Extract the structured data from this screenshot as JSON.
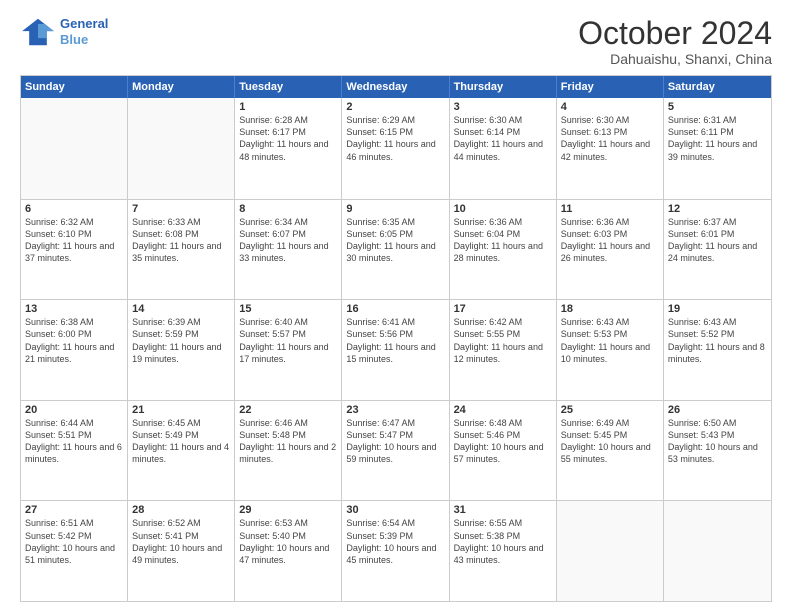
{
  "logo": {
    "line1": "General",
    "line2": "Blue"
  },
  "title": "October 2024",
  "location": "Dahuaishu, Shanxi, China",
  "days_of_week": [
    "Sunday",
    "Monday",
    "Tuesday",
    "Wednesday",
    "Thursday",
    "Friday",
    "Saturday"
  ],
  "weeks": [
    [
      {
        "day": "",
        "empty": true
      },
      {
        "day": "",
        "empty": true
      },
      {
        "day": "1",
        "sunrise": "6:28 AM",
        "sunset": "6:17 PM",
        "daylight": "11 hours and 48 minutes."
      },
      {
        "day": "2",
        "sunrise": "6:29 AM",
        "sunset": "6:15 PM",
        "daylight": "11 hours and 46 minutes."
      },
      {
        "day": "3",
        "sunrise": "6:30 AM",
        "sunset": "6:14 PM",
        "daylight": "11 hours and 44 minutes."
      },
      {
        "day": "4",
        "sunrise": "6:30 AM",
        "sunset": "6:13 PM",
        "daylight": "11 hours and 42 minutes."
      },
      {
        "day": "5",
        "sunrise": "6:31 AM",
        "sunset": "6:11 PM",
        "daylight": "11 hours and 39 minutes."
      }
    ],
    [
      {
        "day": "6",
        "sunrise": "6:32 AM",
        "sunset": "6:10 PM",
        "daylight": "11 hours and 37 minutes."
      },
      {
        "day": "7",
        "sunrise": "6:33 AM",
        "sunset": "6:08 PM",
        "daylight": "11 hours and 35 minutes."
      },
      {
        "day": "8",
        "sunrise": "6:34 AM",
        "sunset": "6:07 PM",
        "daylight": "11 hours and 33 minutes."
      },
      {
        "day": "9",
        "sunrise": "6:35 AM",
        "sunset": "6:05 PM",
        "daylight": "11 hours and 30 minutes."
      },
      {
        "day": "10",
        "sunrise": "6:36 AM",
        "sunset": "6:04 PM",
        "daylight": "11 hours and 28 minutes."
      },
      {
        "day": "11",
        "sunrise": "6:36 AM",
        "sunset": "6:03 PM",
        "daylight": "11 hours and 26 minutes."
      },
      {
        "day": "12",
        "sunrise": "6:37 AM",
        "sunset": "6:01 PM",
        "daylight": "11 hours and 24 minutes."
      }
    ],
    [
      {
        "day": "13",
        "sunrise": "6:38 AM",
        "sunset": "6:00 PM",
        "daylight": "11 hours and 21 minutes."
      },
      {
        "day": "14",
        "sunrise": "6:39 AM",
        "sunset": "5:59 PM",
        "daylight": "11 hours and 19 minutes."
      },
      {
        "day": "15",
        "sunrise": "6:40 AM",
        "sunset": "5:57 PM",
        "daylight": "11 hours and 17 minutes."
      },
      {
        "day": "16",
        "sunrise": "6:41 AM",
        "sunset": "5:56 PM",
        "daylight": "11 hours and 15 minutes."
      },
      {
        "day": "17",
        "sunrise": "6:42 AM",
        "sunset": "5:55 PM",
        "daylight": "11 hours and 12 minutes."
      },
      {
        "day": "18",
        "sunrise": "6:43 AM",
        "sunset": "5:53 PM",
        "daylight": "11 hours and 10 minutes."
      },
      {
        "day": "19",
        "sunrise": "6:43 AM",
        "sunset": "5:52 PM",
        "daylight": "11 hours and 8 minutes."
      }
    ],
    [
      {
        "day": "20",
        "sunrise": "6:44 AM",
        "sunset": "5:51 PM",
        "daylight": "11 hours and 6 minutes."
      },
      {
        "day": "21",
        "sunrise": "6:45 AM",
        "sunset": "5:49 PM",
        "daylight": "11 hours and 4 minutes."
      },
      {
        "day": "22",
        "sunrise": "6:46 AM",
        "sunset": "5:48 PM",
        "daylight": "11 hours and 2 minutes."
      },
      {
        "day": "23",
        "sunrise": "6:47 AM",
        "sunset": "5:47 PM",
        "daylight": "10 hours and 59 minutes."
      },
      {
        "day": "24",
        "sunrise": "6:48 AM",
        "sunset": "5:46 PM",
        "daylight": "10 hours and 57 minutes."
      },
      {
        "day": "25",
        "sunrise": "6:49 AM",
        "sunset": "5:45 PM",
        "daylight": "10 hours and 55 minutes."
      },
      {
        "day": "26",
        "sunrise": "6:50 AM",
        "sunset": "5:43 PM",
        "daylight": "10 hours and 53 minutes."
      }
    ],
    [
      {
        "day": "27",
        "sunrise": "6:51 AM",
        "sunset": "5:42 PM",
        "daylight": "10 hours and 51 minutes."
      },
      {
        "day": "28",
        "sunrise": "6:52 AM",
        "sunset": "5:41 PM",
        "daylight": "10 hours and 49 minutes."
      },
      {
        "day": "29",
        "sunrise": "6:53 AM",
        "sunset": "5:40 PM",
        "daylight": "10 hours and 47 minutes."
      },
      {
        "day": "30",
        "sunrise": "6:54 AM",
        "sunset": "5:39 PM",
        "daylight": "10 hours and 45 minutes."
      },
      {
        "day": "31",
        "sunrise": "6:55 AM",
        "sunset": "5:38 PM",
        "daylight": "10 hours and 43 minutes."
      },
      {
        "day": "",
        "empty": true
      },
      {
        "day": "",
        "empty": true
      }
    ]
  ]
}
